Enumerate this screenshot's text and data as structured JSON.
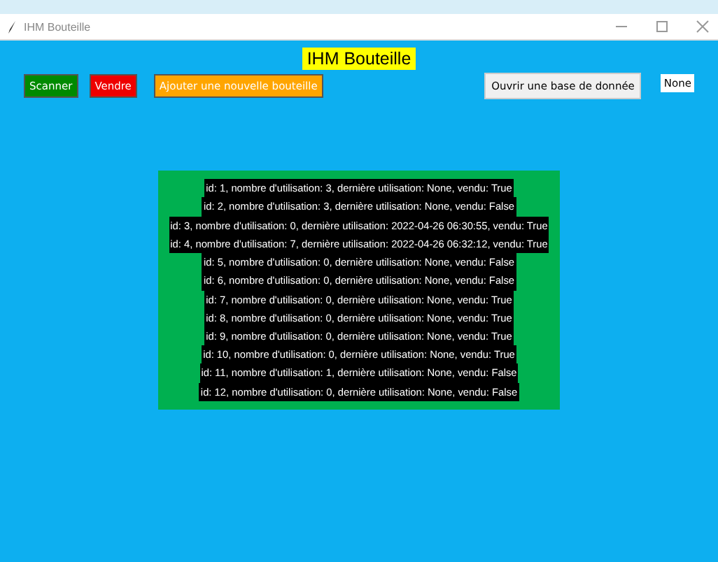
{
  "window": {
    "title": "IHM Bouteille"
  },
  "heading": "IHM Bouteille",
  "buttons": [
    {
      "label": "Scanner",
      "kind": "green"
    },
    {
      "label": "Vendre",
      "kind": "red"
    },
    {
      "label": "Ajouter une nouvelle bouteille",
      "kind": "orange"
    }
  ],
  "database_button": "Ouvrir une base de donnée",
  "database_status": "None",
  "bottles": [
    "id: 1, nombre d'utilisation: 3, dernière utilisation: None, vendu: True",
    "id: 2, nombre d'utilisation: 3, dernière utilisation: None, vendu: False",
    "id: 3, nombre d'utilisation: 0, dernière utilisation: 2022-04-26 06:30:55, vendu: True",
    "id: 4, nombre d'utilisation: 7, dernière utilisation: 2022-04-26 06:32:12, vendu: True",
    "id: 5, nombre d'utilisation: 0, dernière utilisation: None, vendu: False",
    "id: 6, nombre d'utilisation: 0, dernière utilisation: None, vendu: False",
    "id: 7, nombre d'utilisation: 0, dernière utilisation: None, vendu: True",
    "id: 8, nombre d'utilisation: 0, dernière utilisation: None, vendu: True",
    "id: 9, nombre d'utilisation: 0, dernière utilisation: None, vendu: True",
    "id: 10, nombre d'utilisation: 0, dernière utilisation: None, vendu: True",
    "id: 11, nombre d'utilisation: 1, dernière utilisation: None, vendu: False",
    "id: 12, nombre d'utilisation: 0, dernière utilisation: None, vendu: False"
  ]
}
